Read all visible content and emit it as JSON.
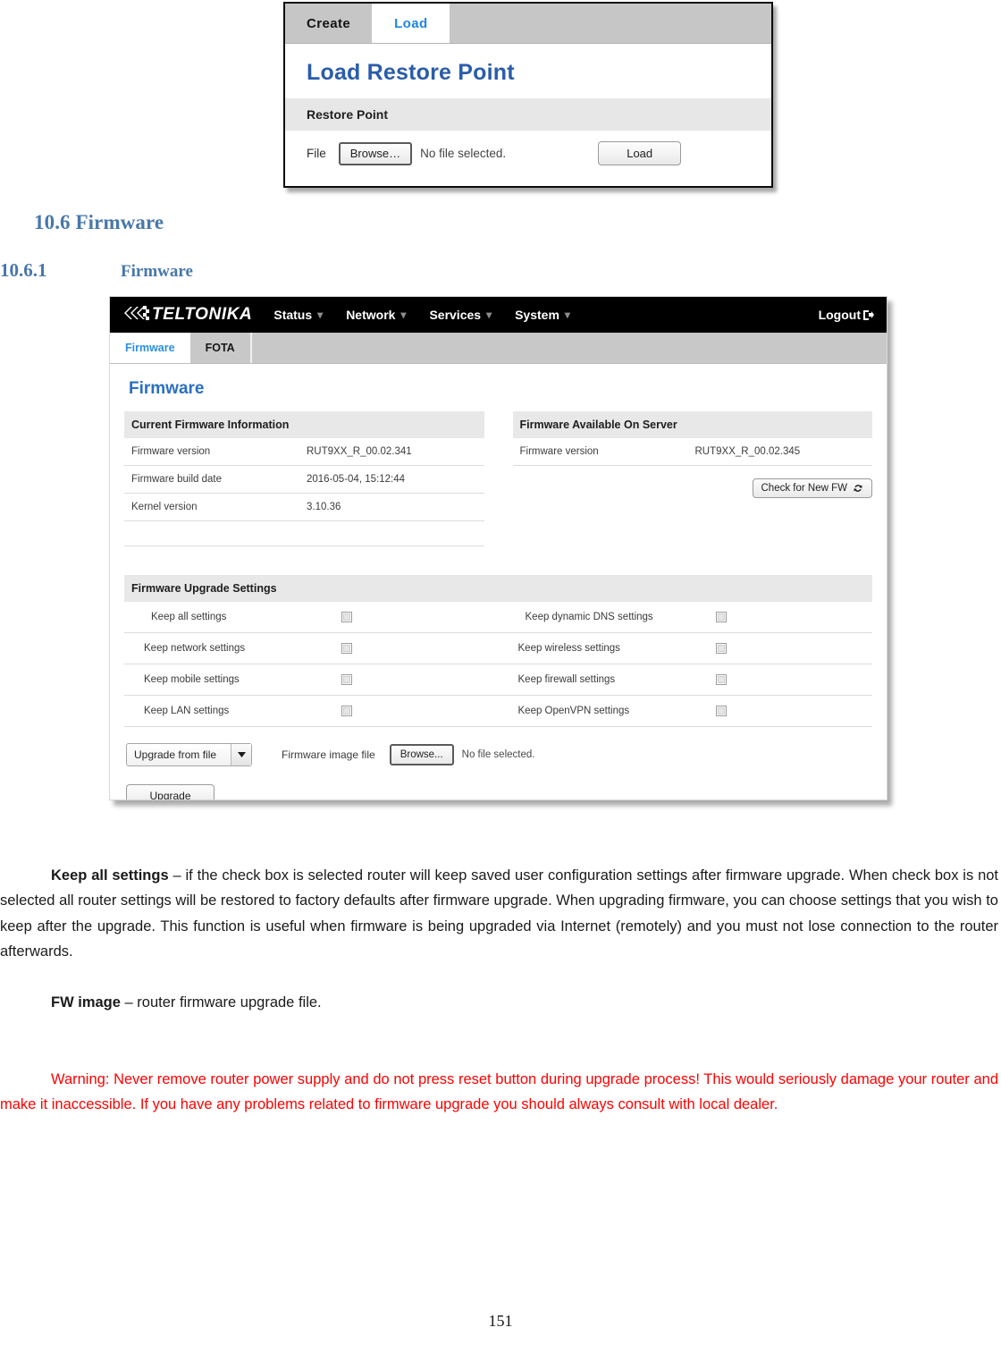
{
  "document": {
    "page_number": "151",
    "heading_section": "10.6 Firmware",
    "heading_sub_number": "10.6.1",
    "heading_sub_title": "Firmware",
    "paragraphs": {
      "keep_all_settings_bold": "Keep all settings",
      "keep_all_settings_text": " – if the check box is selected router will keep saved user configuration settings after firmware upgrade. When check box is not selected all router settings will be restored to factory defaults after firmware upgrade. When upgrading firmware, you can choose settings that you wish to keep after the upgrade. This function is useful when firmware is being upgraded via Internet (remotely) and you must not lose connection to the router afterwards.",
      "fw_image_bold": "FW image",
      "fw_image_text": " – router firmware upgrade file.",
      "warning_text": "Warning: Never remove router power supply and do not press reset button during upgrade process! This would seriously damage your router and make it inaccessible. If you have any problems related to firmware upgrade you should always consult with local dealer."
    }
  },
  "restore_point_screenshot": {
    "tabs": [
      {
        "label": "Create",
        "active": false
      },
      {
        "label": "Load",
        "active": true
      }
    ],
    "title": "Load Restore Point",
    "section_header": "Restore Point",
    "file_label": "File",
    "browse_label": "Browse…",
    "no_file_text": "No file selected.",
    "load_label": "Load"
  },
  "firmware_screenshot": {
    "brand": "TELTONIKA",
    "nav": [
      {
        "label": "Status"
      },
      {
        "label": "Network"
      },
      {
        "label": "Services"
      },
      {
        "label": "System"
      }
    ],
    "logout_label": "Logout",
    "tabs": [
      {
        "label": "Firmware",
        "active": true
      },
      {
        "label": "FOTA",
        "active": false
      }
    ],
    "page_title": "Firmware",
    "current_firmware": {
      "header": "Current Firmware Information",
      "rows": [
        {
          "key": "Firmware version",
          "value": "RUT9XX_R_00.02.341"
        },
        {
          "key": "Firmware build date",
          "value": "2016-05-04, 15:12:44"
        },
        {
          "key": "Kernel version",
          "value": "3.10.36"
        }
      ]
    },
    "server_firmware": {
      "header": "Firmware Available On Server",
      "rows": [
        {
          "key": "Firmware version",
          "value": "RUT9XX_R_00.02.345"
        }
      ],
      "check_button_label": "Check for New FW"
    },
    "upgrade_settings": {
      "header": "Firmware Upgrade Settings",
      "rows": [
        {
          "left_label": "Keep all settings",
          "left_checked": false,
          "right_label": "Keep dynamic DNS settings",
          "right_checked": false
        },
        {
          "left_label": "Keep network settings",
          "left_checked": false,
          "right_label": "Keep wireless settings",
          "right_checked": false
        },
        {
          "left_label": "Keep mobile settings",
          "left_checked": false,
          "right_label": "Keep firewall settings",
          "right_checked": false
        },
        {
          "left_label": "Keep LAN settings",
          "left_checked": false,
          "right_label": "Keep OpenVPN settings",
          "right_checked": false
        }
      ]
    },
    "upgrade_controls": {
      "source_select_value": "Upgrade from file",
      "image_file_label": "Firmware image file",
      "browse_label": "Browse...",
      "no_file_text": "No file selected.",
      "upgrade_button_label": "Upgrade"
    },
    "colors": {
      "navbar_bg": "#000000",
      "tab_active_text": "#2b8fe0",
      "title_text": "#2a6fc0",
      "section_bg": "#e8e8e8"
    }
  }
}
